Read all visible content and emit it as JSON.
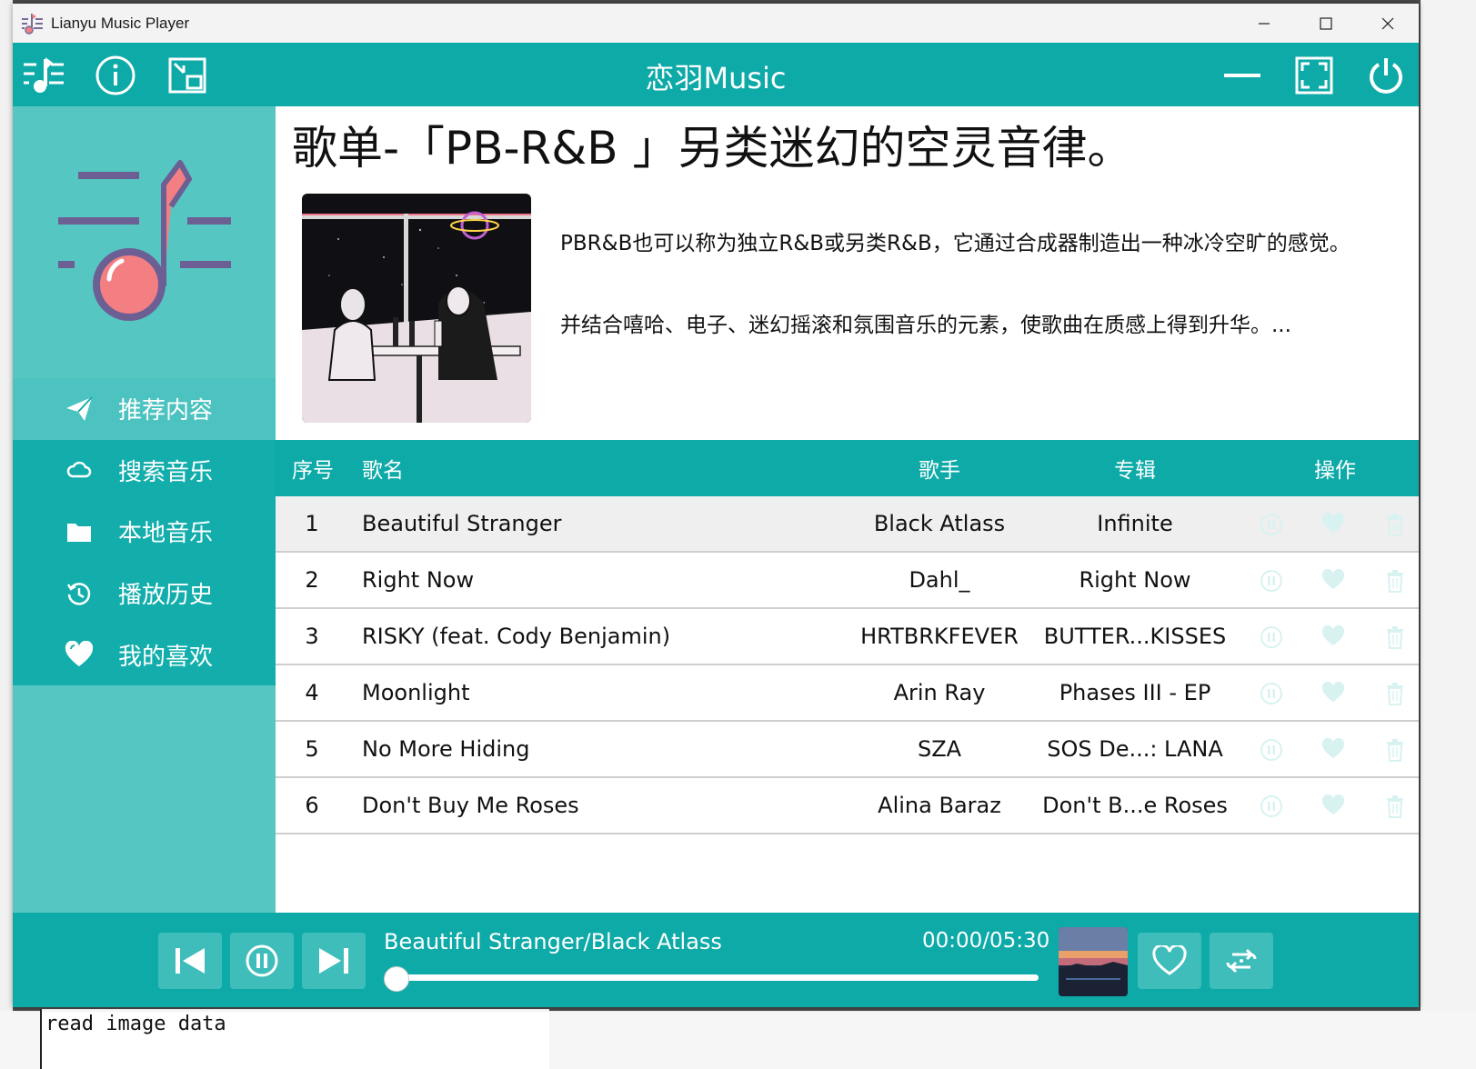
{
  "window": {
    "title": "Lianyu Music Player"
  },
  "header": {
    "title": "恋羽Music"
  },
  "sidebar": {
    "items": [
      {
        "label": "推荐内容",
        "icon": "paper-plane-icon",
        "active": true
      },
      {
        "label": "搜索音乐",
        "icon": "cloud-icon",
        "active": false
      },
      {
        "label": "本地音乐",
        "icon": "folder-icon",
        "active": false
      },
      {
        "label": "播放历史",
        "icon": "history-icon",
        "active": false
      },
      {
        "label": "我的喜欢",
        "icon": "heart-icon",
        "active": false
      }
    ]
  },
  "playlist": {
    "title": "歌单-「PB-R&B 」另类迷幻的空灵音律。",
    "description": [
      "PBR&B也可以称为独立R&B或另类R&B，它通过合成器制造出一种冰冷空旷的感觉。",
      "并结合嘻哈、电子、迷幻摇滚和氛围音乐的元素，使歌曲在质感上得到升华。..."
    ]
  },
  "table": {
    "headers": {
      "no": "序号",
      "name": "歌名",
      "artist": "歌手",
      "album": "专辑",
      "ops": "操作"
    },
    "rows": [
      {
        "no": "1",
        "name": "Beautiful Stranger",
        "artist": "Black Atlass",
        "album": "Infinite"
      },
      {
        "no": "2",
        "name": "Right Now",
        "artist": "Dahl_",
        "album": "Right Now"
      },
      {
        "no": "3",
        "name": "RISKY (feat. Cody Benjamin)",
        "artist": "HRTBRKFEVER",
        "album": "BUTTER...KISSES"
      },
      {
        "no": "4",
        "name": "Moonlight",
        "artist": "Arin Ray",
        "album": "Phases III - EP"
      },
      {
        "no": "5",
        "name": "No More Hiding",
        "artist": "SZA",
        "album": "SOS De...: LANA"
      },
      {
        "no": "6",
        "name": "Don't Buy Me Roses",
        "artist": "Alina Baraz",
        "album": "Don't B...e Roses"
      }
    ]
  },
  "player": {
    "now_playing": "Beautiful Stranger/Black Atlass",
    "time": "00:00/05:30",
    "progress": 0
  },
  "background": {
    "terminal_text": "read image data"
  },
  "colors": {
    "header": "#0eaaa8",
    "sidebar": "#56c6c3",
    "nav": "#13aeac",
    "nav_active": "#4cc3c0"
  }
}
